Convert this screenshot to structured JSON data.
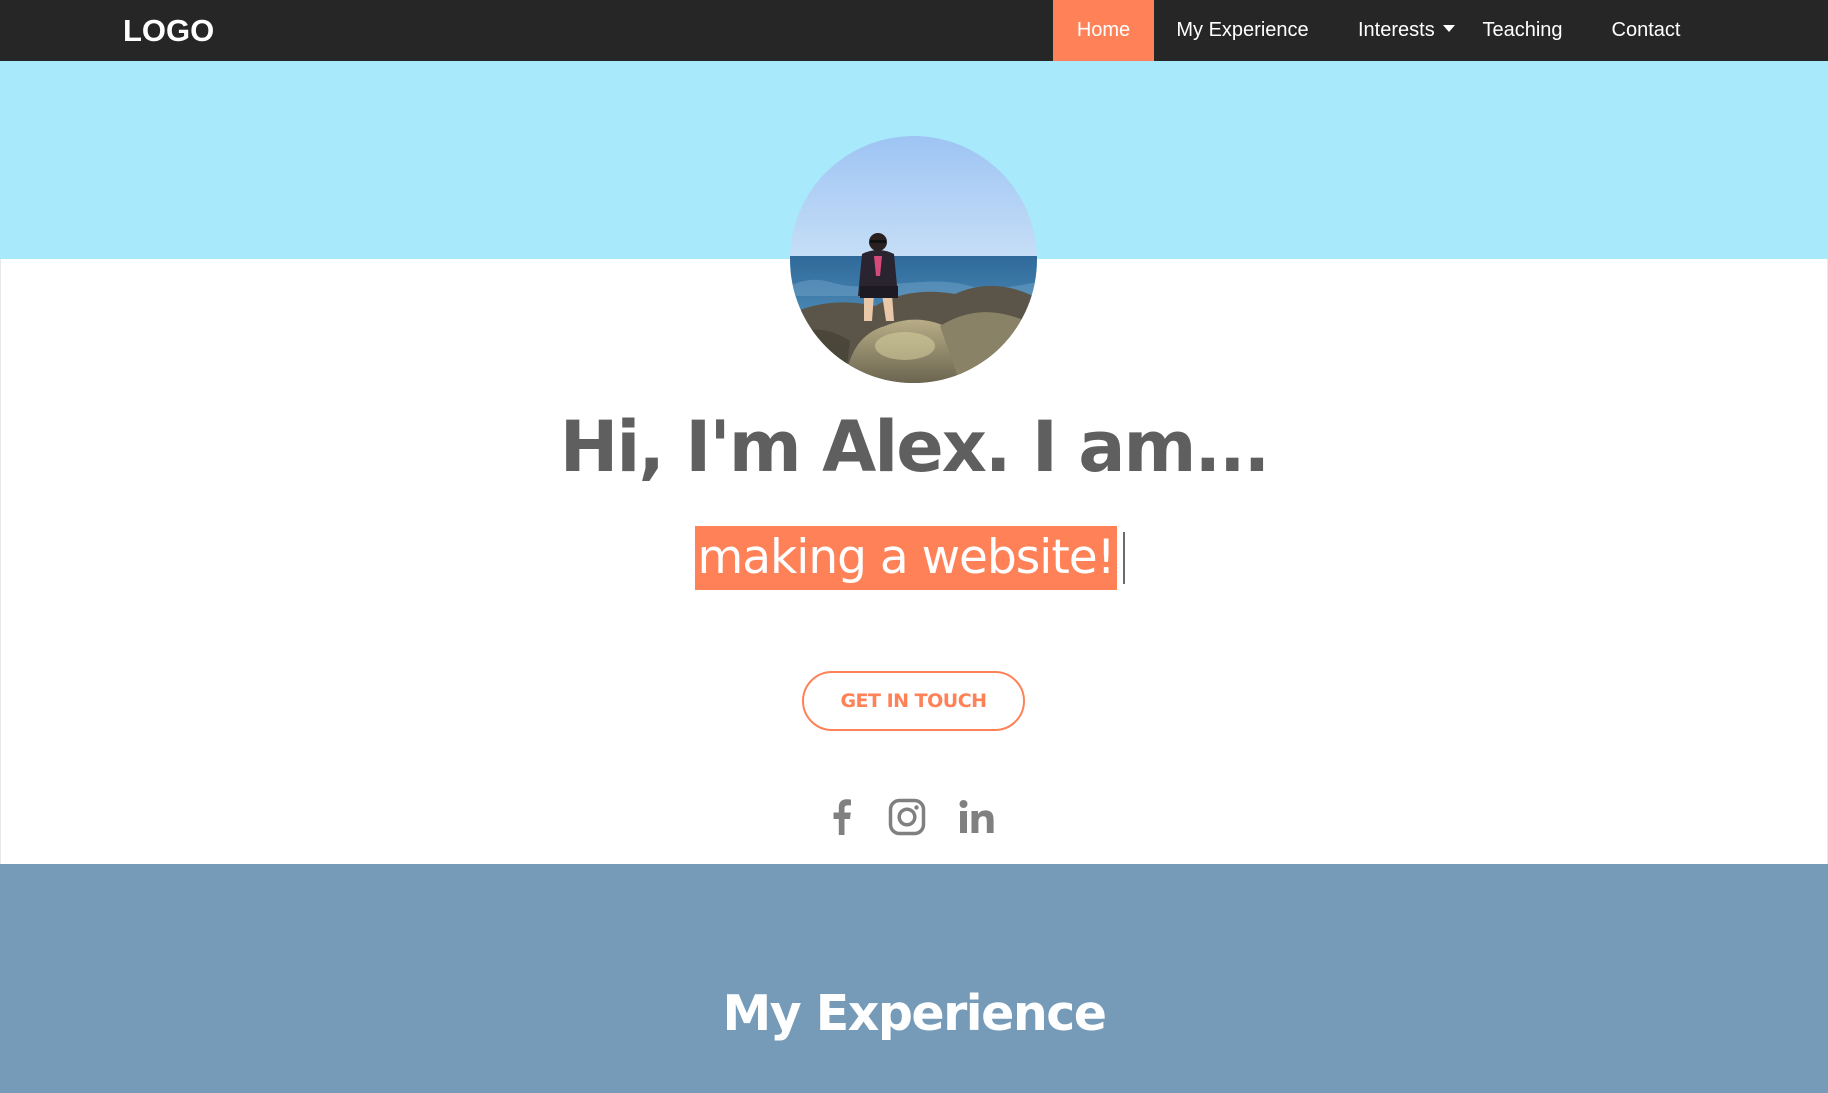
{
  "navbar": {
    "logo": "LOGO",
    "items": [
      {
        "label": "Home",
        "active": true
      },
      {
        "label": "My Experience"
      },
      {
        "label": "Interests",
        "icon": "caret-down-icon"
      },
      {
        "label": "Teaching"
      },
      {
        "label": "Contact"
      }
    ]
  },
  "hero": {
    "avatar_alt": "profile-photo",
    "headline": "Hi, I'm Alex. I am...",
    "typed_text": "making a website!",
    "cta_label": "GET IN TOUCH",
    "social": [
      {
        "icon": "facebook-icon"
      },
      {
        "icon": "instagram-icon"
      },
      {
        "icon": "linkedin-icon"
      }
    ]
  },
  "experience": {
    "title": "My Experience"
  },
  "colors": {
    "navbar_bg": "#262626",
    "accent": "#ff8157",
    "hero_top_bg": "#a8e9fb",
    "headline_text": "#5f5f5f",
    "experience_bg": "#759bb9",
    "social_icon": "#808080"
  }
}
